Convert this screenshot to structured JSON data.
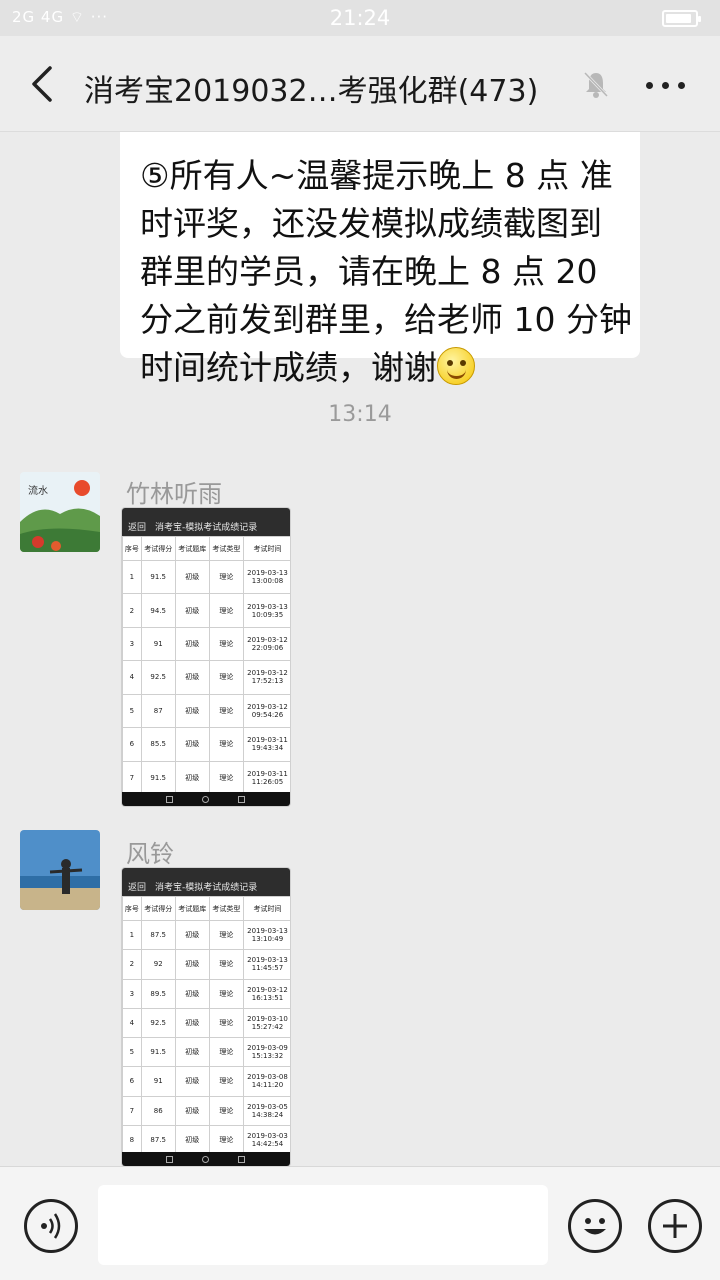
{
  "status_bar": {
    "left": "2G 4G ⌔ ···",
    "time": "21:24",
    "battery_level": 0.9
  },
  "header": {
    "title": "消考宝2019032…考强化群(473)",
    "back_icon": "back-arrow-icon",
    "mute_icon": "bell-muted-icon",
    "more_icon": "more-dots-icon"
  },
  "messages": {
    "text_bubble": {
      "text": "⑤所有人~温馨提示晚上 8 点 准时评奖，还没发模拟成绩截图到群里的学员，请在晚上 8 点 20 分之前发到群里，给老师 10 分钟时间统计成绩，谢谢"
    },
    "timestamp": "13:14",
    "msg1": {
      "sender": "竹林听雨",
      "screenshot": {
        "title": "消考宝-模拟考试成绩记录",
        "back": "返回",
        "headers": [
          "序号",
          "考试得分",
          "考试题库",
          "考试类型",
          "考试时间"
        ],
        "rows": [
          [
            "1",
            "91.5",
            "初级",
            "理论",
            "2019-03-13\n13:00:08"
          ],
          [
            "2",
            "94.5",
            "初级",
            "理论",
            "2019-03-13\n10:09:35"
          ],
          [
            "3",
            "91",
            "初级",
            "理论",
            "2019-03-12\n22:09:06"
          ],
          [
            "4",
            "92.5",
            "初级",
            "理论",
            "2019-03-12\n17:52:13"
          ],
          [
            "5",
            "87",
            "初级",
            "理论",
            "2019-03-12\n09:54:26"
          ],
          [
            "6",
            "85.5",
            "初级",
            "理论",
            "2019-03-11\n19:43:34"
          ],
          [
            "7",
            "91.5",
            "初级",
            "理论",
            "2019-03-11\n11:26:05"
          ]
        ]
      }
    },
    "msg2": {
      "sender": "风铃",
      "screenshot": {
        "title": "消考宝-模拟考试成绩记录",
        "back": "返回",
        "headers": [
          "序号",
          "考试得分",
          "考试题库",
          "考试类型",
          "考试时间"
        ],
        "rows": [
          [
            "1",
            "87.5",
            "初级",
            "理论",
            "2019-03-13\n13:10:49"
          ],
          [
            "2",
            "92",
            "初级",
            "理论",
            "2019-03-13\n11:45:57"
          ],
          [
            "3",
            "89.5",
            "初级",
            "理论",
            "2019-03-12\n16:13:51"
          ],
          [
            "4",
            "92.5",
            "初级",
            "理论",
            "2019-03-10\n15:27:42"
          ],
          [
            "5",
            "91.5",
            "初级",
            "理论",
            "2019-03-09\n15:13:32"
          ],
          [
            "6",
            "91",
            "初级",
            "理论",
            "2019-03-08\n14:11:20"
          ],
          [
            "7",
            "86",
            "初级",
            "理论",
            "2019-03-05\n14:38:24"
          ],
          [
            "8",
            "87.5",
            "初级",
            "理论",
            "2019-03-03\n14:42:54"
          ]
        ]
      }
    }
  },
  "input_bar": {
    "voice_icon": "voice-icon",
    "emoji_icon": "emoji-icon",
    "plus_icon": "plus-icon",
    "input_value": ""
  }
}
